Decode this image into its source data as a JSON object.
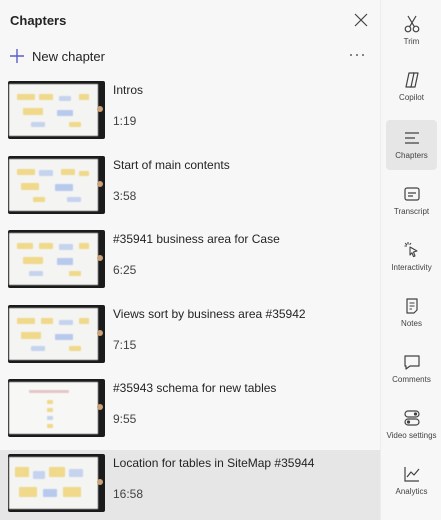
{
  "panel": {
    "title": "Chapters",
    "new_chapter_label": "New chapter"
  },
  "chapters": [
    {
      "title": "Intros",
      "time": "1:19"
    },
    {
      "title": "Start of main contents",
      "time": "3:58"
    },
    {
      "title": "#35941 business area for Case",
      "time": "6:25"
    },
    {
      "title": "Views sort by business area #35942",
      "time": "7:15"
    },
    {
      "title": "#35943 schema for new tables",
      "time": "9:55"
    },
    {
      "title": "Location for tables in SiteMap #35944",
      "time": "16:58"
    }
  ],
  "rail": [
    {
      "label": "Trim",
      "icon": "scissors-icon"
    },
    {
      "label": "Copilot",
      "icon": "copilot-icon"
    },
    {
      "label": "Chapters",
      "icon": "chapters-icon"
    },
    {
      "label": "Transcript",
      "icon": "transcript-icon"
    },
    {
      "label": "Interactivity",
      "icon": "interactivity-icon"
    },
    {
      "label": "Notes",
      "icon": "notes-icon"
    },
    {
      "label": "Comments",
      "icon": "comments-icon"
    },
    {
      "label": "Video settings",
      "icon": "video-settings-icon"
    },
    {
      "label": "Analytics",
      "icon": "analytics-icon"
    }
  ],
  "colors": {
    "accent": "#5b5fc7",
    "background": "#f7f7f7",
    "selected": "#e6e6e6"
  }
}
